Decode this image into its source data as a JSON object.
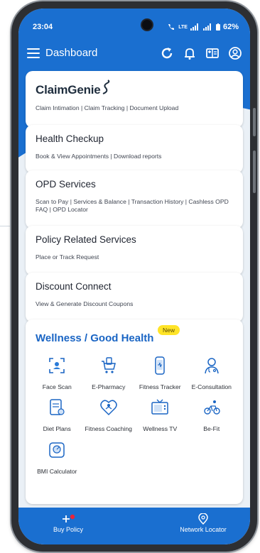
{
  "status_bar": {
    "time": "23:04",
    "battery": "62%",
    "carrier_tag": "LTE"
  },
  "app_bar": {
    "title": "Dashboard",
    "icons": [
      "menu-icon",
      "refresh-icon",
      "bell-icon",
      "card-icon",
      "profile-icon"
    ]
  },
  "services": [
    {
      "logo": "ClaimGenie",
      "subtitle": "Claim Intimation | Claim Tracking | Document Upload"
    },
    {
      "title": "Health Checkup",
      "subtitle": "Book & View Appointments | Download reports"
    },
    {
      "title": "OPD Services",
      "subtitle": "Scan to Pay | Services & Balance | Transaction History | Cashless OPD FAQ | OPD Locator"
    },
    {
      "title": "Policy Related Services",
      "subtitle": "Place or Track Request"
    },
    {
      "title": "Discount Connect",
      "subtitle": "View & Generate Discount Coupons"
    }
  ],
  "wellness": {
    "title": "Wellness / Good Health",
    "badge": "New",
    "items": [
      {
        "label": "Face Scan",
        "icon": "face-scan-icon"
      },
      {
        "label": "E-Pharmacy",
        "icon": "cart-icon"
      },
      {
        "label": "Fitness Tracker",
        "icon": "tracker-icon"
      },
      {
        "label": "E-Consultation",
        "icon": "doctor-icon"
      },
      {
        "label": "Diet Plans",
        "icon": "diet-icon"
      },
      {
        "label": "Fitness Coaching",
        "icon": "coaching-icon"
      },
      {
        "label": "Wellness TV",
        "icon": "tv-icon"
      },
      {
        "label": "Be-Fit",
        "icon": "bike-icon"
      },
      {
        "label": "BMI Calculator",
        "icon": "scale-icon"
      }
    ]
  },
  "bottom_bar": {
    "buy_policy": "Buy Policy",
    "network_locator": "Network Locator"
  },
  "colors": {
    "primary": "#1a6fd0",
    "badge": "#ffe428",
    "title_blue": "#1a65c4"
  }
}
